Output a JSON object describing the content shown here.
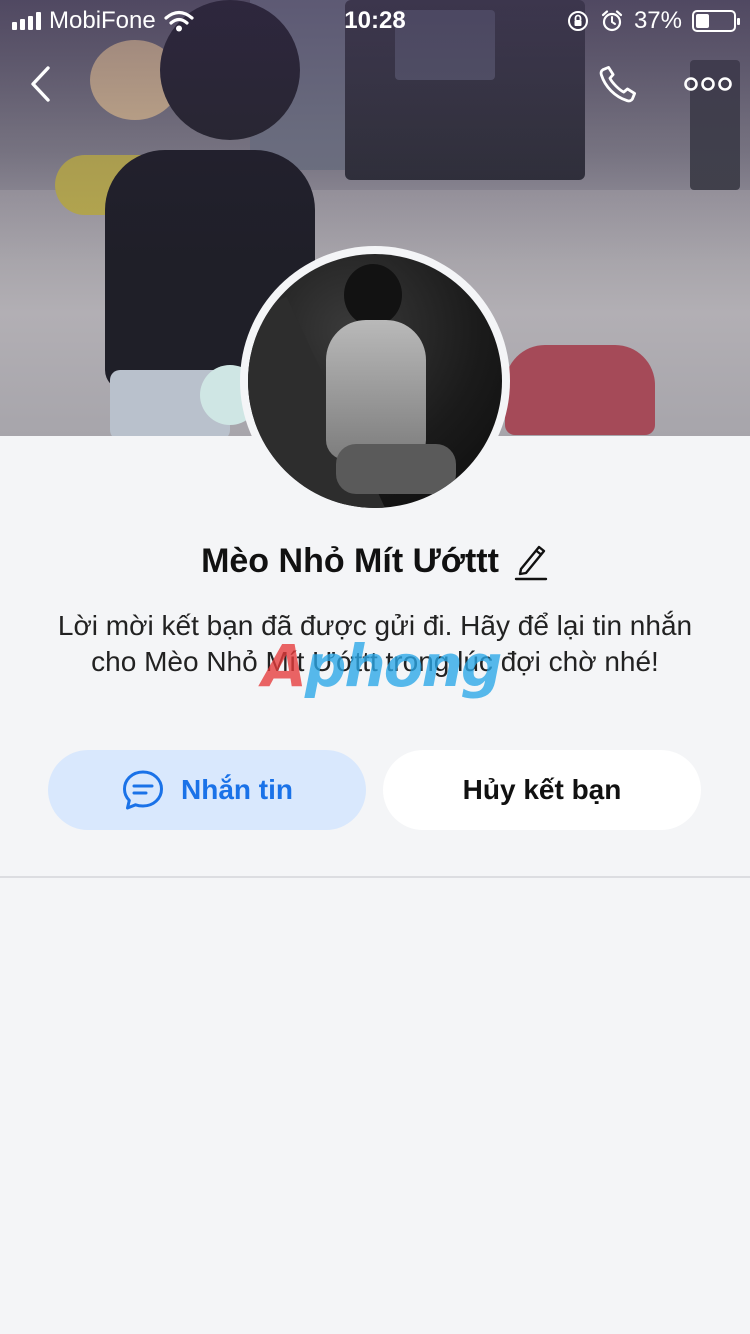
{
  "status_bar": {
    "carrier": "MobiFone",
    "time": "10:28",
    "battery_percent": "37%",
    "battery_level": 0.37
  },
  "icons": {
    "back": "chevron-left-icon",
    "call": "phone-icon",
    "more": "more-dots-icon",
    "edit": "pencil-icon",
    "message": "chat-bubble-icon"
  },
  "profile": {
    "name": "Mèo Nhỏ Mít Ướttt",
    "description": "Lời mời kết bạn đã được gửi đi. Hãy để lại tin nhắn cho Mèo Nhỏ Mít Ướttt trong lúc đợi chờ nhé!"
  },
  "watermark": {
    "first": "A",
    "rest": "phong"
  },
  "actions": {
    "message_label": "Nhắn tin",
    "unfriend_label": "Hủy kết bạn"
  },
  "colors": {
    "accent": "#1a72e8",
    "message_button_bg": "#d9e8fd",
    "page_bg": "#f4f5f7"
  }
}
